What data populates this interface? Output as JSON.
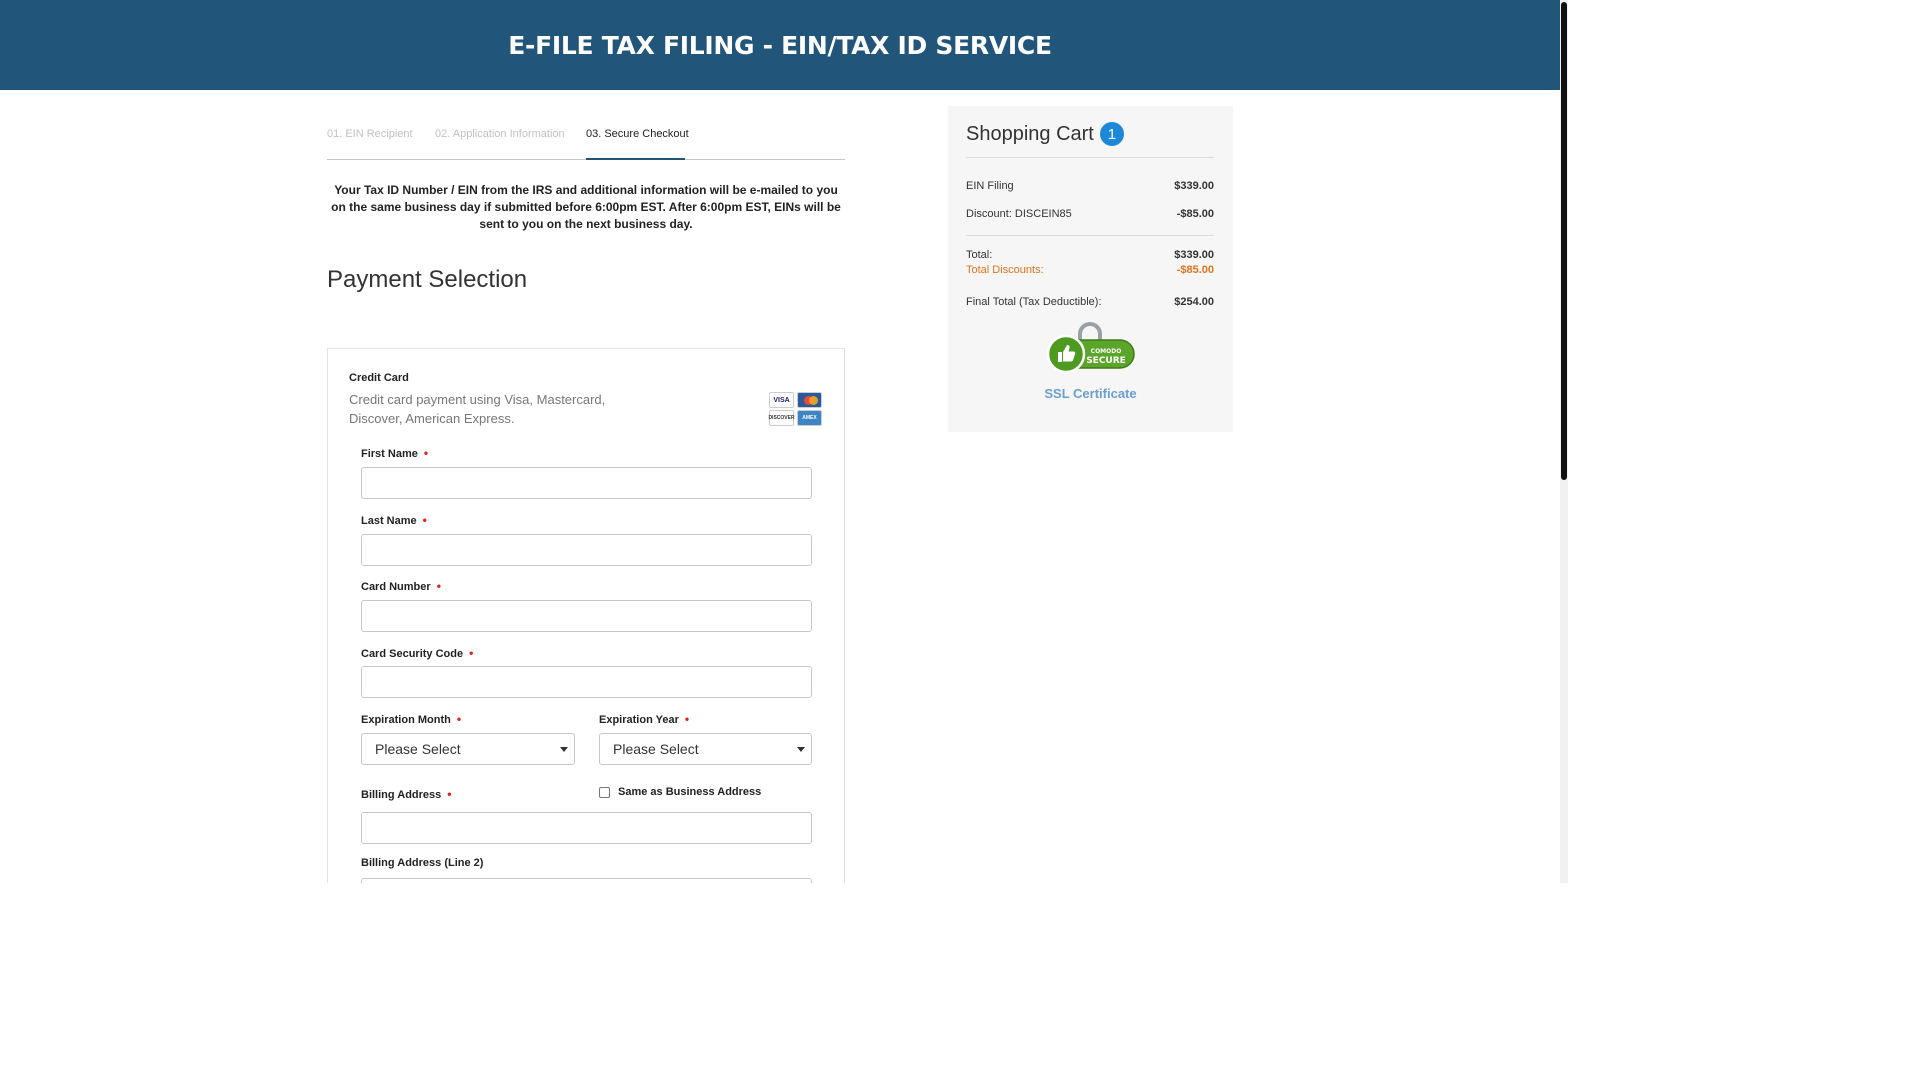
{
  "header": {
    "title": "E-FILE TAX FILING - EIN/TAX ID SERVICE"
  },
  "steps": [
    {
      "label": "01. EIN Recipient"
    },
    {
      "label": "02. Application Information"
    },
    {
      "label": "03. Secure Checkout"
    }
  ],
  "notice": "Your Tax ID Number / EIN from the IRS and additional information will be e-mailed to you on the same business day if submitted before 6:00pm EST. After 6:00pm EST, EINs will be sent to you on the next business day.",
  "payment": {
    "section_title": "Payment Selection",
    "method_title": "Credit Card",
    "method_desc": "Credit card payment using Visa, Mastercard, Discover, American Express.",
    "card_logos": {
      "visa": "VISA",
      "discover": "DISCOVER",
      "amex": "AMEX"
    },
    "fields": {
      "first_name": "First Name",
      "last_name": "Last Name",
      "card_number": "Card Number",
      "security_code": "Card Security Code",
      "exp_month": "Expiration Month",
      "exp_year": "Expiration Year",
      "billing_address": "Billing Address",
      "billing_address2": "Billing Address (Line 2)"
    },
    "exp_month_value": "Please Select",
    "exp_year_value": "Please Select",
    "same_address_label": "Same as Business Address",
    "required_mark": "•"
  },
  "cart": {
    "title": "Shopping Cart",
    "count": "1",
    "items": [
      {
        "label": "EIN Filing",
        "amount": "$339.00"
      },
      {
        "label": "Discount: DISCEIN85",
        "amount": "-$85.00"
      }
    ],
    "total_label": "Total:",
    "total_amount": "$339.00",
    "discounts_label": "Total Discounts:",
    "discounts_amount": "-$85.00",
    "final_label": "Final Total (Tax Deductible):",
    "final_amount": "$254.00",
    "ssl_label": "SSL Certificate",
    "seal_text": {
      "brand": "COMODO",
      "word": "SECURE"
    }
  },
  "colors": {
    "header_bg": "#215579",
    "cart_badge": "#1e88d8",
    "discount": "#e0741c",
    "required": "#e02020",
    "ssl_link": "#6a9fd0"
  }
}
